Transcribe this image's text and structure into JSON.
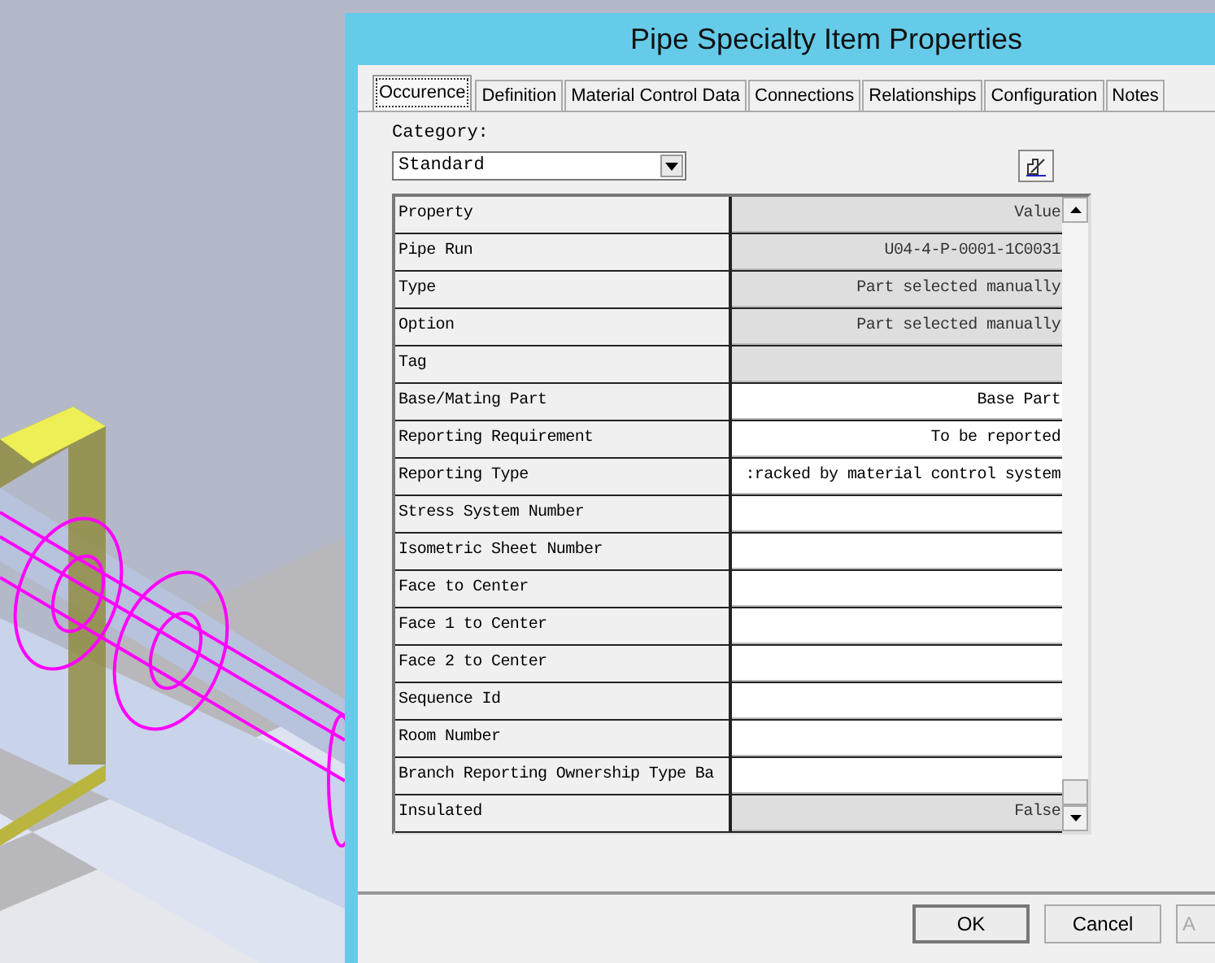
{
  "window": {
    "title": "Pipe Specialty Item Properties"
  },
  "tabs": [
    {
      "label": "Occurence",
      "selected": true
    },
    {
      "label": "Definition",
      "selected": false
    },
    {
      "label": "Material Control Data",
      "selected": false
    },
    {
      "label": "Connections",
      "selected": false
    },
    {
      "label": "Relationships",
      "selected": false
    },
    {
      "label": "Configuration",
      "selected": false
    },
    {
      "label": "Notes",
      "selected": false
    }
  ],
  "category": {
    "label": "Category:",
    "value": "Standard"
  },
  "grid": {
    "columns": [
      "Property",
      "Value"
    ],
    "rows": [
      {
        "property": "Pipe Run",
        "value": "U04-4-P-0001-1C0031",
        "readonly": true
      },
      {
        "property": "Type",
        "value": "Part selected manually",
        "readonly": true
      },
      {
        "property": "Option",
        "value": "Part selected manually",
        "readonly": true
      },
      {
        "property": "Tag",
        "value": "",
        "readonly": true
      },
      {
        "property": "Base/Mating Part",
        "value": "Base Part",
        "readonly": false
      },
      {
        "property": "Reporting Requirement",
        "value": "To be reported",
        "readonly": false
      },
      {
        "property": "Reporting Type",
        "value": ":racked by material control system",
        "readonly": false
      },
      {
        "property": "Stress System Number",
        "value": "",
        "readonly": false
      },
      {
        "property": "Isometric Sheet Number",
        "value": "",
        "readonly": false
      },
      {
        "property": "Face to Center",
        "value": "",
        "readonly": false
      },
      {
        "property": "Face 1 to Center",
        "value": "",
        "readonly": false
      },
      {
        "property": "Face 2 to Center",
        "value": "",
        "readonly": false
      },
      {
        "property": "Sequence Id",
        "value": "",
        "readonly": false
      },
      {
        "property": "Room Number",
        "value": "",
        "readonly": false
      },
      {
        "property": "Branch Reporting Ownership Type Ba",
        "value": "",
        "readonly": false
      },
      {
        "property": "Insulated",
        "value": "False",
        "readonly": true
      }
    ]
  },
  "buttons": [
    {
      "label": "OK",
      "disabled": false,
      "default": true
    },
    {
      "label": "Cancel",
      "disabled": false,
      "default": false
    },
    {
      "label": "A",
      "disabled": true,
      "default": false
    }
  ]
}
